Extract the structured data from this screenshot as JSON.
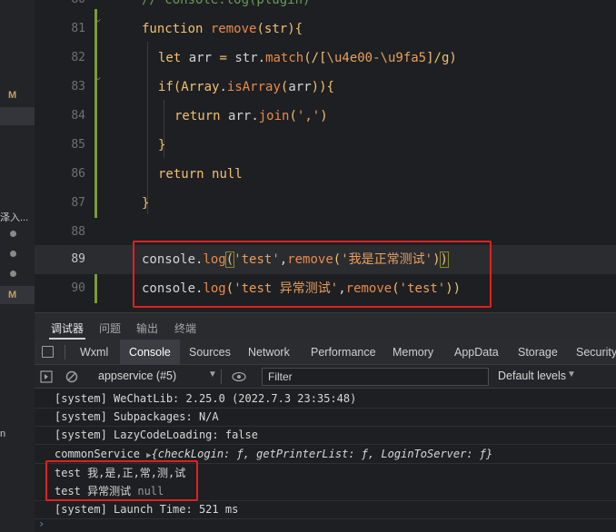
{
  "sidebar": {
    "marker_m": "M",
    "clipped_label": "泽入...",
    "clipped_label2": "n"
  },
  "editor": {
    "lines": [
      {
        "n": "80",
        "text": "// console.log(plugin)"
      },
      {
        "n": "81",
        "text": "function remove(str){"
      },
      {
        "n": "82",
        "text": "let arr = str.match(/[\\u4e00-\\u9fa5]/g)"
      },
      {
        "n": "83",
        "text": "if(Array.isArray(arr)){"
      },
      {
        "n": "84",
        "text": "return arr.join(',')"
      },
      {
        "n": "85",
        "text": "}"
      },
      {
        "n": "86",
        "text": "return null"
      },
      {
        "n": "87",
        "text": "}"
      },
      {
        "n": "88",
        "text": ""
      },
      {
        "n": "89",
        "text": "console.log('test',remove('我是正常测试'))"
      },
      {
        "n": "90",
        "text": "console.log('test 异常测试',remove('test'))"
      }
    ]
  },
  "panel_tabs": [
    "调试器",
    "问题",
    "输出",
    "终端"
  ],
  "devtools_tabs": [
    "Wxml",
    "Console",
    "Sources",
    "Network",
    "Performance",
    "Memory",
    "AppData",
    "Storage",
    "Security"
  ],
  "console_bar": {
    "context": "appservice (#5)",
    "filter_placeholder": "Filter",
    "levels": "Default levels"
  },
  "console_lines": [
    "[system] WeChatLib: 2.25.0 (2022.7.3 23:35:48)",
    "[system] Subpackages: N/A",
    "[system] LazyCodeLoading: false",
    "commonService",
    "{checkLogin: ƒ, getPrinterList: ƒ, LoginToServer: ƒ}",
    "test 我,是,正,常,测,试",
    "test 异常测试",
    "null",
    "[system] Launch Time: 521 ms"
  ],
  "colors": {
    "highlight_box": "#e02020",
    "keyword": "#f0c070",
    "function_name": "#e88a4c",
    "background": "#1e1f22"
  }
}
